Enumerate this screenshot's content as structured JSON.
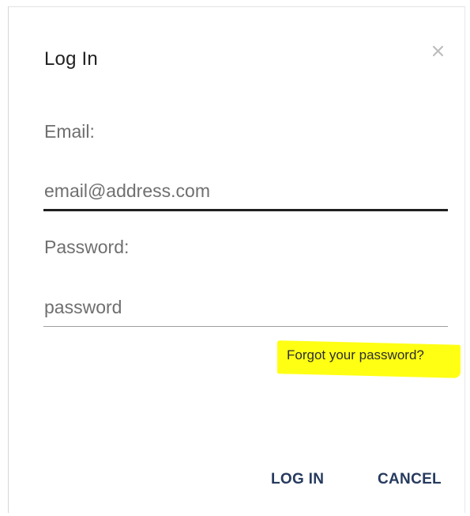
{
  "dialog": {
    "title": "Log In",
    "close_icon": "close-icon"
  },
  "form": {
    "email_label": "Email:",
    "email_placeholder": "email@address.com",
    "email_value": "",
    "password_label": "Password:",
    "password_placeholder": "password",
    "password_value": "",
    "forgot_link": "Forgot your password?",
    "highlight_color": "#ffff14"
  },
  "actions": {
    "login_label": "LOG IN",
    "cancel_label": "CANCEL",
    "button_color": "#263a5e"
  }
}
